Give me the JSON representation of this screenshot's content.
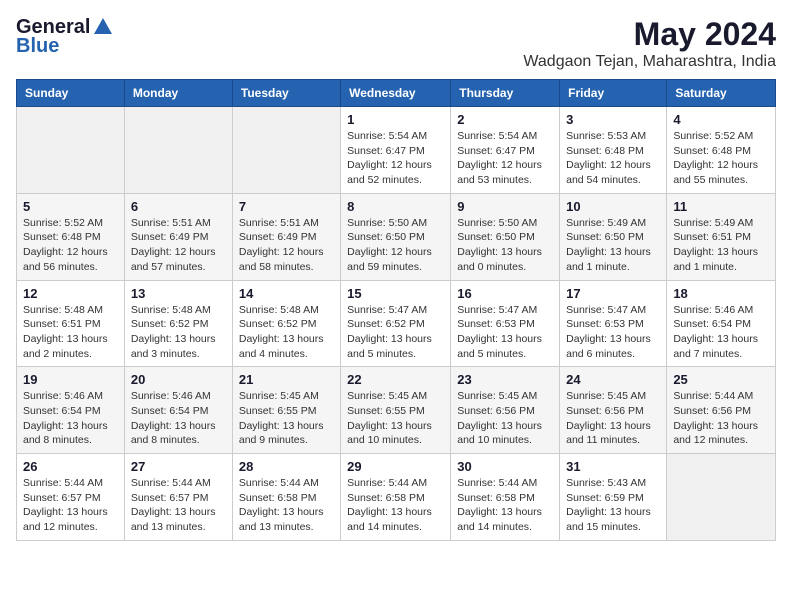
{
  "logo": {
    "general": "General",
    "blue": "Blue"
  },
  "title": "May 2024",
  "subtitle": "Wadgaon Tejan, Maharashtra, India",
  "days_of_week": [
    "Sunday",
    "Monday",
    "Tuesday",
    "Wednesday",
    "Thursday",
    "Friday",
    "Saturday"
  ],
  "weeks": [
    [
      {
        "day": "",
        "info": ""
      },
      {
        "day": "",
        "info": ""
      },
      {
        "day": "",
        "info": ""
      },
      {
        "day": "1",
        "info": "Sunrise: 5:54 AM\nSunset: 6:47 PM\nDaylight: 12 hours\nand 52 minutes."
      },
      {
        "day": "2",
        "info": "Sunrise: 5:54 AM\nSunset: 6:47 PM\nDaylight: 12 hours\nand 53 minutes."
      },
      {
        "day": "3",
        "info": "Sunrise: 5:53 AM\nSunset: 6:48 PM\nDaylight: 12 hours\nand 54 minutes."
      },
      {
        "day": "4",
        "info": "Sunrise: 5:52 AM\nSunset: 6:48 PM\nDaylight: 12 hours\nand 55 minutes."
      }
    ],
    [
      {
        "day": "5",
        "info": "Sunrise: 5:52 AM\nSunset: 6:48 PM\nDaylight: 12 hours\nand 56 minutes."
      },
      {
        "day": "6",
        "info": "Sunrise: 5:51 AM\nSunset: 6:49 PM\nDaylight: 12 hours\nand 57 minutes."
      },
      {
        "day": "7",
        "info": "Sunrise: 5:51 AM\nSunset: 6:49 PM\nDaylight: 12 hours\nand 58 minutes."
      },
      {
        "day": "8",
        "info": "Sunrise: 5:50 AM\nSunset: 6:50 PM\nDaylight: 12 hours\nand 59 minutes."
      },
      {
        "day": "9",
        "info": "Sunrise: 5:50 AM\nSunset: 6:50 PM\nDaylight: 13 hours\nand 0 minutes."
      },
      {
        "day": "10",
        "info": "Sunrise: 5:49 AM\nSunset: 6:50 PM\nDaylight: 13 hours\nand 1 minute."
      },
      {
        "day": "11",
        "info": "Sunrise: 5:49 AM\nSunset: 6:51 PM\nDaylight: 13 hours\nand 1 minute."
      }
    ],
    [
      {
        "day": "12",
        "info": "Sunrise: 5:48 AM\nSunset: 6:51 PM\nDaylight: 13 hours\nand 2 minutes."
      },
      {
        "day": "13",
        "info": "Sunrise: 5:48 AM\nSunset: 6:52 PM\nDaylight: 13 hours\nand 3 minutes."
      },
      {
        "day": "14",
        "info": "Sunrise: 5:48 AM\nSunset: 6:52 PM\nDaylight: 13 hours\nand 4 minutes."
      },
      {
        "day": "15",
        "info": "Sunrise: 5:47 AM\nSunset: 6:52 PM\nDaylight: 13 hours\nand 5 minutes."
      },
      {
        "day": "16",
        "info": "Sunrise: 5:47 AM\nSunset: 6:53 PM\nDaylight: 13 hours\nand 5 minutes."
      },
      {
        "day": "17",
        "info": "Sunrise: 5:47 AM\nSunset: 6:53 PM\nDaylight: 13 hours\nand 6 minutes."
      },
      {
        "day": "18",
        "info": "Sunrise: 5:46 AM\nSunset: 6:54 PM\nDaylight: 13 hours\nand 7 minutes."
      }
    ],
    [
      {
        "day": "19",
        "info": "Sunrise: 5:46 AM\nSunset: 6:54 PM\nDaylight: 13 hours\nand 8 minutes."
      },
      {
        "day": "20",
        "info": "Sunrise: 5:46 AM\nSunset: 6:54 PM\nDaylight: 13 hours\nand 8 minutes."
      },
      {
        "day": "21",
        "info": "Sunrise: 5:45 AM\nSunset: 6:55 PM\nDaylight: 13 hours\nand 9 minutes."
      },
      {
        "day": "22",
        "info": "Sunrise: 5:45 AM\nSunset: 6:55 PM\nDaylight: 13 hours\nand 10 minutes."
      },
      {
        "day": "23",
        "info": "Sunrise: 5:45 AM\nSunset: 6:56 PM\nDaylight: 13 hours\nand 10 minutes."
      },
      {
        "day": "24",
        "info": "Sunrise: 5:45 AM\nSunset: 6:56 PM\nDaylight: 13 hours\nand 11 minutes."
      },
      {
        "day": "25",
        "info": "Sunrise: 5:44 AM\nSunset: 6:56 PM\nDaylight: 13 hours\nand 12 minutes."
      }
    ],
    [
      {
        "day": "26",
        "info": "Sunrise: 5:44 AM\nSunset: 6:57 PM\nDaylight: 13 hours\nand 12 minutes."
      },
      {
        "day": "27",
        "info": "Sunrise: 5:44 AM\nSunset: 6:57 PM\nDaylight: 13 hours\nand 13 minutes."
      },
      {
        "day": "28",
        "info": "Sunrise: 5:44 AM\nSunset: 6:58 PM\nDaylight: 13 hours\nand 13 minutes."
      },
      {
        "day": "29",
        "info": "Sunrise: 5:44 AM\nSunset: 6:58 PM\nDaylight: 13 hours\nand 14 minutes."
      },
      {
        "day": "30",
        "info": "Sunrise: 5:44 AM\nSunset: 6:58 PM\nDaylight: 13 hours\nand 14 minutes."
      },
      {
        "day": "31",
        "info": "Sunrise: 5:43 AM\nSunset: 6:59 PM\nDaylight: 13 hours\nand 15 minutes."
      },
      {
        "day": "",
        "info": ""
      }
    ]
  ]
}
